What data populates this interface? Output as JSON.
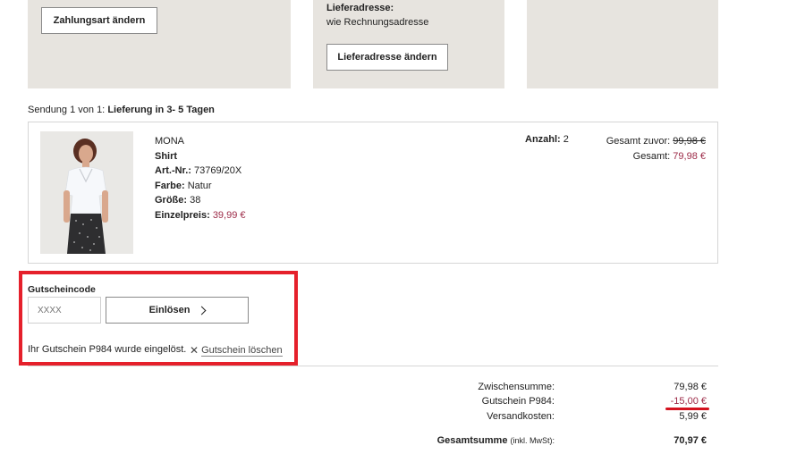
{
  "payment": {
    "change_button": "Zahlungsart ändern"
  },
  "delivery": {
    "label": "Lieferadresse:",
    "value": "wie Rechnungsadresse",
    "change_button": "Lieferadresse ändern"
  },
  "shipment": {
    "prefix": "Sendung 1 von 1:",
    "title": "Lieferung in 3- 5 Tagen"
  },
  "item": {
    "brand": "MONA",
    "name": "Shirt",
    "article_label": "Art.-Nr.:",
    "article_value": "73769/20X",
    "color_label": "Farbe:",
    "color_value": "Natur",
    "size_label": "Größe:",
    "size_value": "38",
    "unit_price_label": "Einzelpreis:",
    "unit_price_value": "39,99 €",
    "qty_label": "Anzahl:",
    "qty_value": "2",
    "total_before_label": "Gesamt zuvor:",
    "total_before_value": "99,98 €",
    "total_label": "Gesamt:",
    "total_value": "79,98 €"
  },
  "voucher": {
    "title": "Gutscheincode",
    "placeholder": "XXXX",
    "redeem_button": "Einlösen",
    "message": "Ihr Gutschein P984 wurde eingelöst.",
    "delete_link": "Gutschein löschen"
  },
  "summary": {
    "subtotal_label": "Zwischensumme:",
    "subtotal_value": "79,98 €",
    "voucher_label": "Gutschein P984:",
    "voucher_value": "-15,00 €",
    "shipping_label": "Versandkosten:",
    "shipping_value": "5,99 €",
    "grand_label": "Gesamtsumme",
    "grand_suffix": "(inkl. MwSt):",
    "grand_value": "70,97 €"
  },
  "colors": {
    "panel_bg": "#e7e4df",
    "price_accent": "#9c2a47",
    "highlight_red": "#e5202b"
  }
}
